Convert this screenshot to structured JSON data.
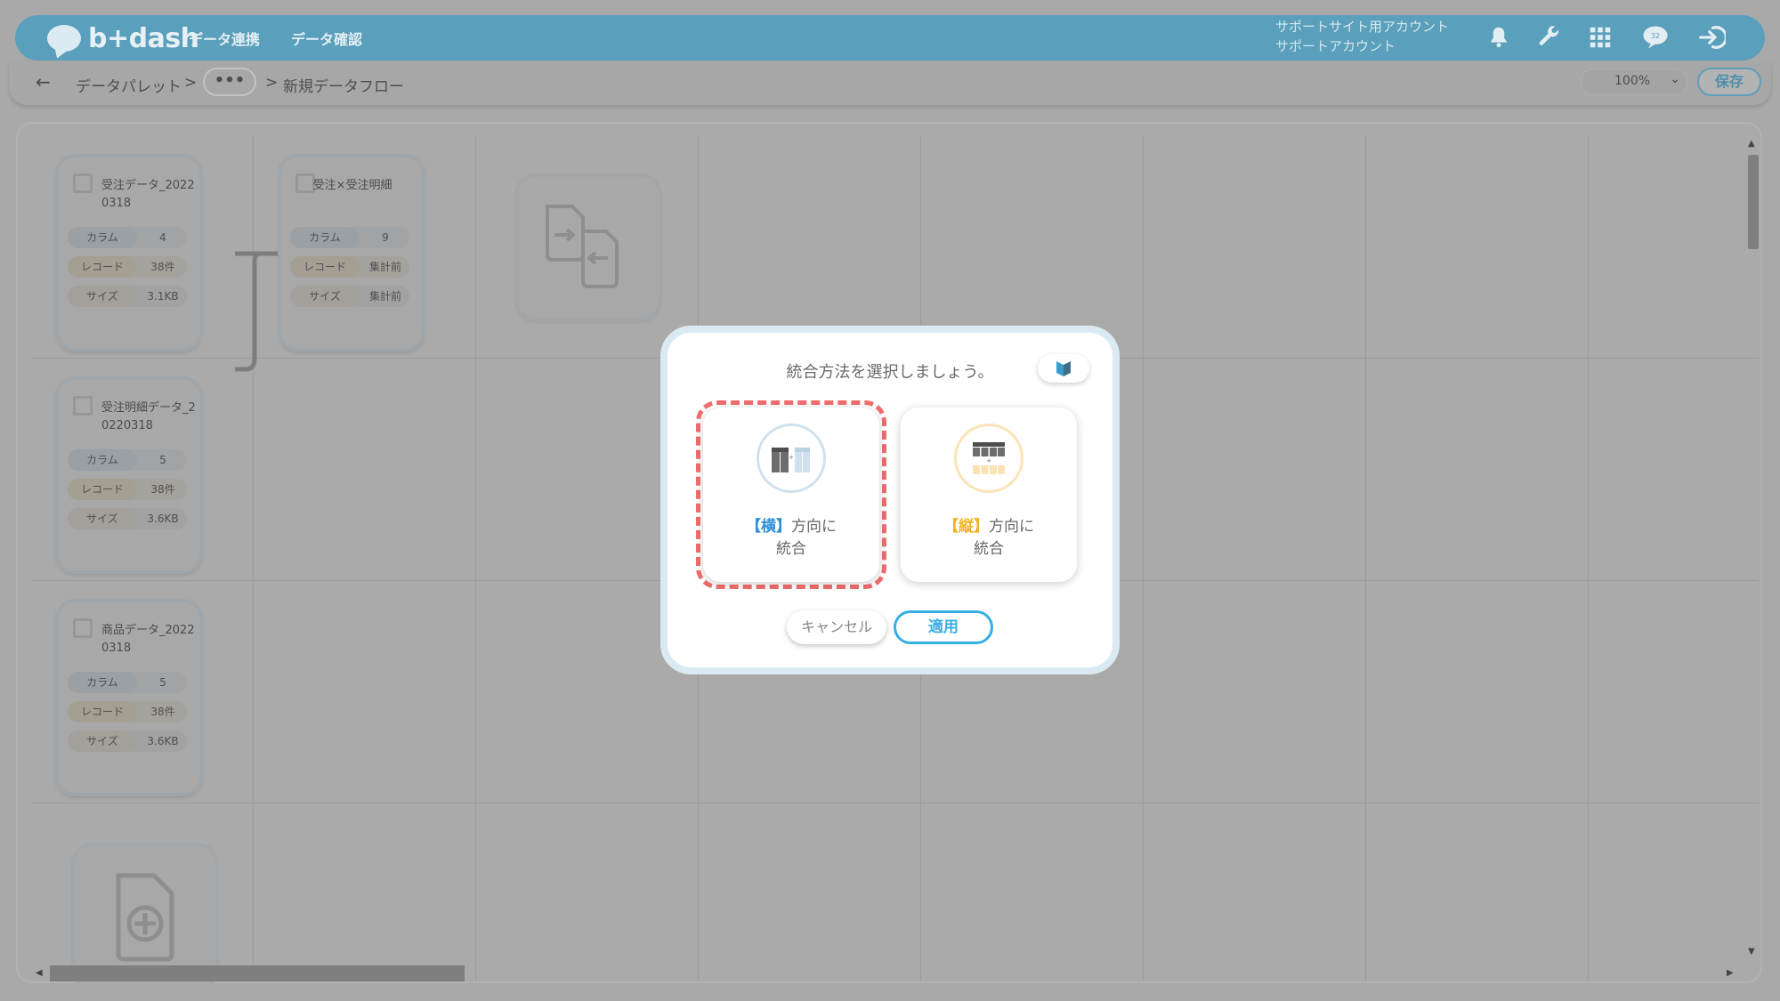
{
  "header": {
    "logo_text": "b+dash",
    "nav": [
      "データ連携",
      "データ確認"
    ],
    "account": {
      "line1": "サポートサイト用アカウント",
      "line2": "サポートアカウント"
    },
    "icons": [
      "bell-icon",
      "wrench-icon",
      "apps-grid-icon",
      "chat-bubble-icon",
      "logout-icon"
    ],
    "chat_badge": "32"
  },
  "breadcrumb": {
    "back": "←",
    "item1": "データパレット",
    "sep": ">",
    "dots": "•••",
    "item2": "新規データフロー",
    "zoom": "100%",
    "save_label": "保存"
  },
  "cards": [
    {
      "title": "受注データ_20220318",
      "rows": [
        {
          "k": "カラム",
          "v": "4"
        },
        {
          "k": "レコード",
          "v": "38件"
        },
        {
          "k": "サイズ",
          "v": "3.1KB"
        }
      ]
    },
    {
      "title": "受注×受注明細",
      "rows": [
        {
          "k": "カラム",
          "v": "9"
        },
        {
          "k": "レコード",
          "v": "集計前"
        },
        {
          "k": "サイズ",
          "v": "集計前"
        }
      ]
    },
    {
      "title": "受注明細データ_20220318",
      "rows": [
        {
          "k": "カラム",
          "v": "5"
        },
        {
          "k": "レコード",
          "v": "38件"
        },
        {
          "k": "サイズ",
          "v": "3.6KB"
        }
      ]
    },
    {
      "title": "商品データ_20220318",
      "rows": [
        {
          "k": "カラム",
          "v": "5"
        },
        {
          "k": "レコード",
          "v": "38件"
        },
        {
          "k": "サイズ",
          "v": "3.6KB"
        }
      ]
    }
  ],
  "modal": {
    "title": "統合方法を選択しましょう。",
    "option_horizontal": {
      "keyword": "【横】",
      "rest": "方向に",
      "line2": "統合"
    },
    "option_vertical": {
      "keyword": "【縦】",
      "rest": "方向に",
      "line2": "統合"
    },
    "cancel_label": "キャンセル",
    "apply_label": "適用"
  },
  "colors": {
    "header": "#5a9fbb",
    "accent_blue": "#36aee6",
    "highlight": "#f06d6d",
    "vertical": "#efb321"
  }
}
